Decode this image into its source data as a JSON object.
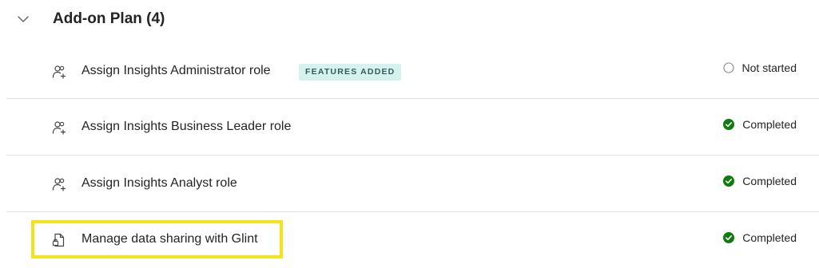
{
  "section": {
    "title": "Add-on Plan (4)",
    "expand_icon": "chevron-down-icon"
  },
  "rows": [
    {
      "label": "Assign Insights Administrator role",
      "icon": "people-add-icon",
      "badge": "FEATURES ADDED",
      "status": "Not started",
      "status_icon": "empty-circle-icon"
    },
    {
      "label": "Assign Insights Business Leader role",
      "icon": "people-add-icon",
      "badge": "",
      "status": "Completed",
      "status_icon": "check-circle-icon"
    },
    {
      "label": "Assign Insights Analyst role",
      "icon": "people-add-icon",
      "badge": "",
      "status": "Completed",
      "status_icon": "check-circle-icon"
    },
    {
      "label": "Manage data sharing with Glint",
      "icon": "document-lock-icon",
      "badge": "",
      "status": "Completed",
      "status_icon": "check-circle-icon"
    }
  ],
  "colors": {
    "completed": "#107c10",
    "not_started_border": "#8a8886",
    "badge_bg": "#d6f2ee",
    "highlight": "#f5e21b"
  }
}
